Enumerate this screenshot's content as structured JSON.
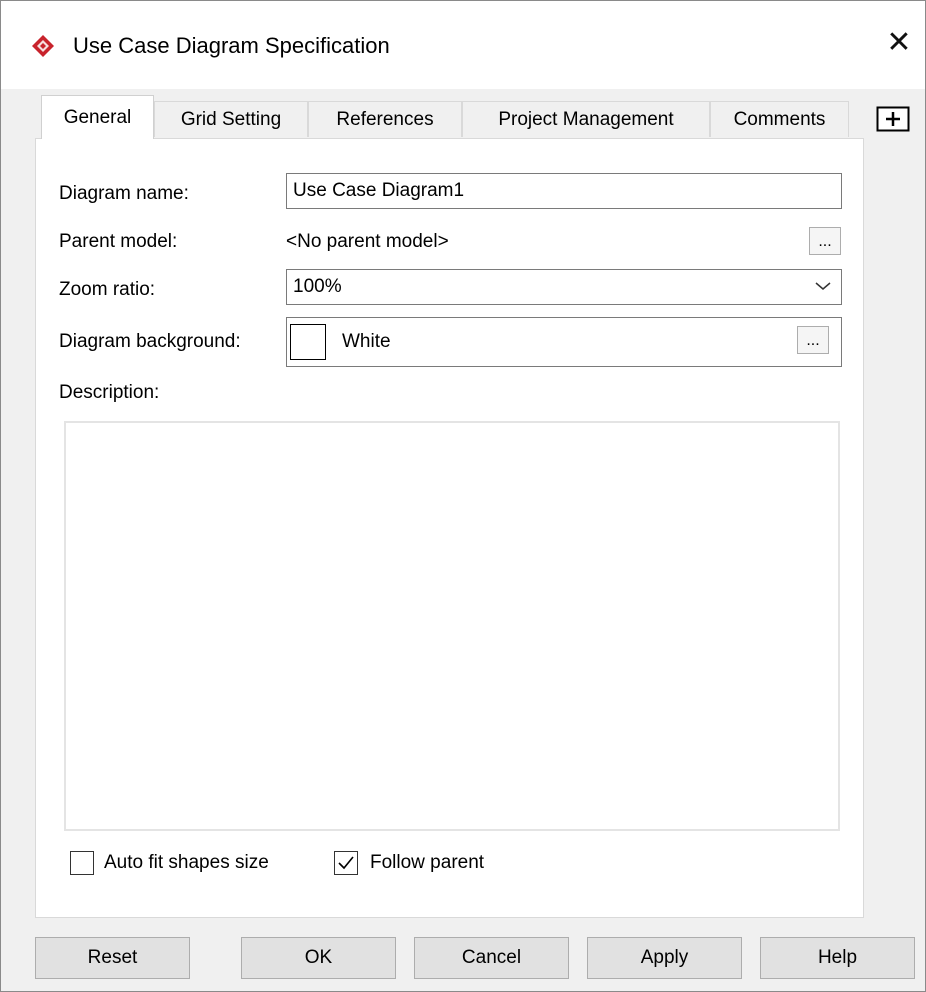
{
  "window": {
    "title": "Use Case Diagram Specification",
    "close_glyph": "✕",
    "brand_color": "#c8232c"
  },
  "tabs": [
    {
      "label": "General",
      "active": true
    },
    {
      "label": "Grid Setting",
      "active": false
    },
    {
      "label": "References",
      "active": false
    },
    {
      "label": "Project Management",
      "active": false
    },
    {
      "label": "Comments",
      "active": false
    }
  ],
  "icons": {
    "app": "visual-paradigm-logo-icon",
    "add_tab": "add-tab-icon",
    "dropdown": "chevron-down-icon",
    "checkmark": "checkmark-icon"
  },
  "form": {
    "diagram_name": {
      "label": "Diagram name:",
      "value": "Use Case Diagram1"
    },
    "parent_model": {
      "label": "Parent model:",
      "value": "<No parent model>",
      "button_label": "..."
    },
    "zoom_ratio": {
      "label": "Zoom ratio:",
      "value": "100%"
    },
    "diagram_background": {
      "label": "Diagram background:",
      "value": "White",
      "swatch_color": "#ffffff",
      "button_label": "..."
    },
    "description": {
      "label": "Description:",
      "value": ""
    }
  },
  "options": {
    "auto_fit": {
      "label": "Auto fit shapes size",
      "checked": false
    },
    "follow_parent": {
      "label": "Follow parent",
      "checked": true
    }
  },
  "buttons": {
    "reset": "Reset",
    "ok": "OK",
    "cancel": "Cancel",
    "apply": "Apply",
    "help": "Help"
  }
}
